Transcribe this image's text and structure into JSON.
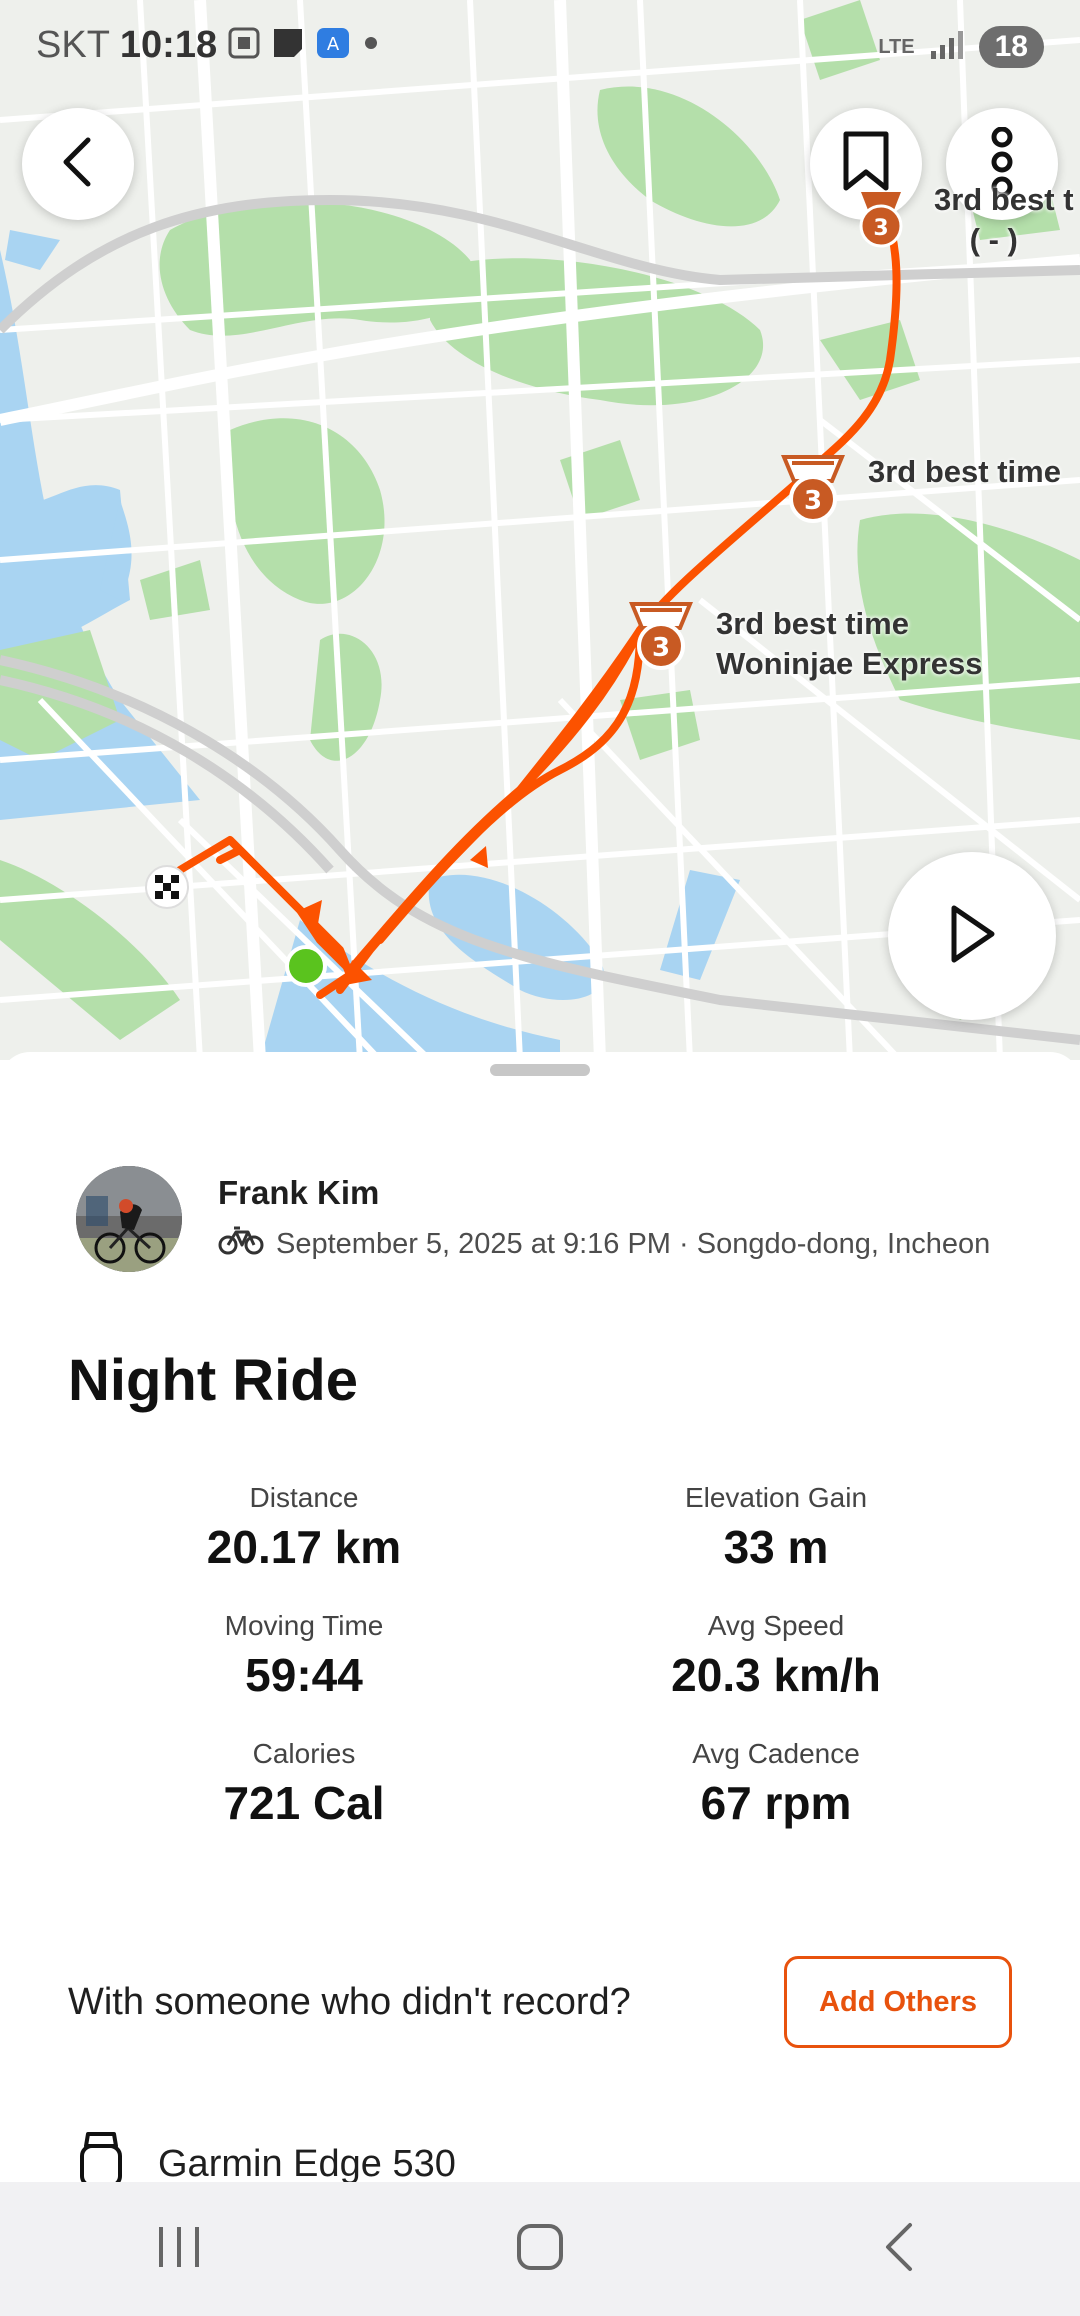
{
  "status_bar": {
    "carrier": "SKT",
    "time": "10:18",
    "network": "LTE",
    "battery": "18"
  },
  "map": {
    "medals": [
      {
        "rank": "3",
        "label_line1": "3rd best time",
        "label_line2": ""
      },
      {
        "rank": "3",
        "label_line1": "3rd best time",
        "label_line2": "Woninjae Express"
      },
      {
        "rank": "3",
        "label_line1": "3rd best t",
        "label_line2": "( - )"
      }
    ],
    "route_color": "#fc5200",
    "icons": [
      "back-icon",
      "bookmark-icon",
      "more-icon",
      "play-icon",
      "finish-flag-icon",
      "start-dot-icon"
    ]
  },
  "activity": {
    "athlete_name": "Frank Kim",
    "meta": "September 5, 2025 at 9:16 PM · Songdo-dong, Incheon",
    "title": "Night Ride",
    "stats": [
      {
        "label": "Distance",
        "value": "20.17 km"
      },
      {
        "label": "Elevation Gain",
        "value": "33 m"
      },
      {
        "label": "Moving Time",
        "value": "59:44"
      },
      {
        "label": "Avg Speed",
        "value": "20.3 km/h"
      },
      {
        "label": "Calories",
        "value": "721 Cal"
      },
      {
        "label": "Avg Cadence",
        "value": "67 rpm"
      }
    ],
    "others_prompt": "With someone who didn't record?",
    "add_others_label": "Add Others",
    "device": "Garmin Edge 530"
  },
  "colors": {
    "accent": "#fc5200",
    "button_text": "#e8520d",
    "map_green": "#9fd49a",
    "map_water": "#a9d4f2"
  },
  "nav_bar": {
    "icons": [
      "recent-apps-icon",
      "home-icon",
      "back-nav-icon"
    ]
  }
}
